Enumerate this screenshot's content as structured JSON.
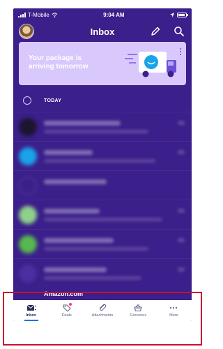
{
  "status": {
    "carrier": "T-Mobile",
    "time": "9:04 AM"
  },
  "header": {
    "title": "Inbox"
  },
  "banner": {
    "text": "Your package is arriving tomorrow"
  },
  "section": {
    "label": "TODAY"
  },
  "list": {
    "last_sender": "Amazon.com"
  },
  "tabs": [
    {
      "label": "Inbox"
    },
    {
      "label": "Deals"
    },
    {
      "label": "Attachments"
    },
    {
      "label": "Groceries"
    },
    {
      "label": "More"
    }
  ],
  "colors": {
    "background": "#3b1f8a",
    "banner": "#d9c8fb",
    "accent": "#1a73e8",
    "annotation": "#c8102e"
  }
}
